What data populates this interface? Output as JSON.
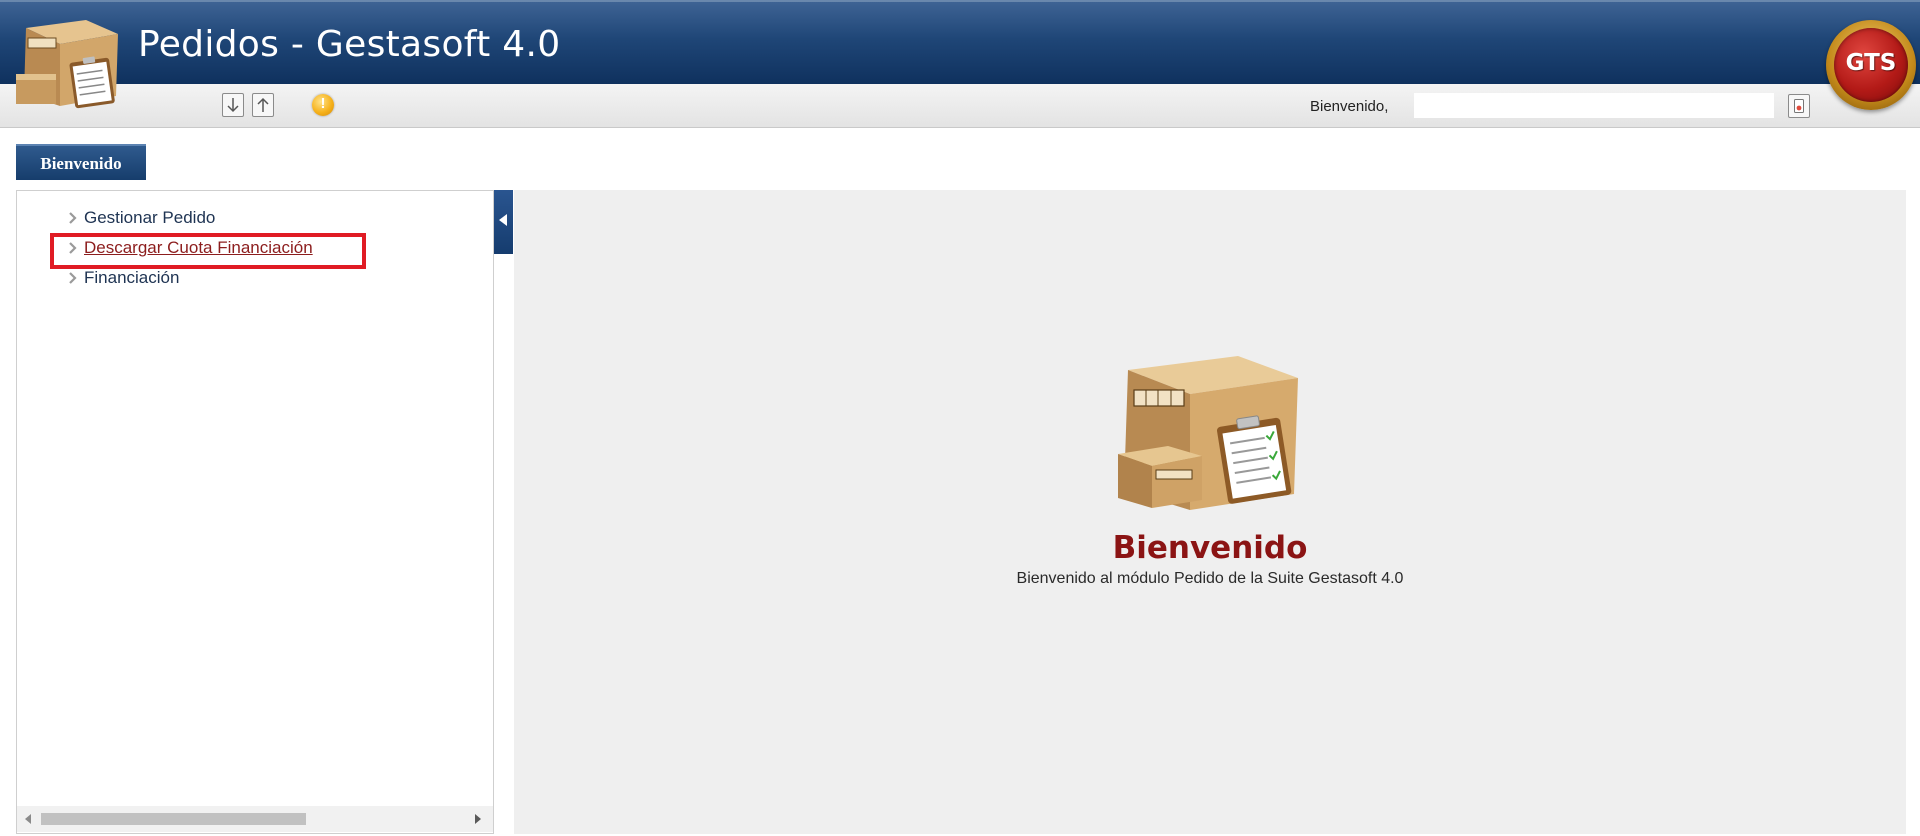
{
  "header": {
    "title": "Pedidos - Gestasoft 4.0",
    "logo_text": "GTS"
  },
  "toolbar": {
    "download_icon": "arrow-down-icon",
    "upload_icon": "arrow-up-icon",
    "info_icon": "info-icon",
    "info_glyph": "!",
    "welcome_label": "Bienvenido,",
    "user_value": "",
    "logout_icon": "logout-icon"
  },
  "tabs": [
    {
      "label": "Bienvenido"
    }
  ],
  "sidebar": {
    "items": [
      {
        "label": "Gestionar Pedido"
      },
      {
        "label": "Descargar Cuota Financiación"
      },
      {
        "label": "Financiación"
      }
    ]
  },
  "main": {
    "title": "Bienvenido",
    "subtitle": "Bienvenido al módulo Pedido de la Suite Gestasoft 4.0"
  },
  "colors": {
    "header_blue": "#1f4677",
    "title_red": "#8b1414",
    "highlight_red": "#e01b24"
  }
}
